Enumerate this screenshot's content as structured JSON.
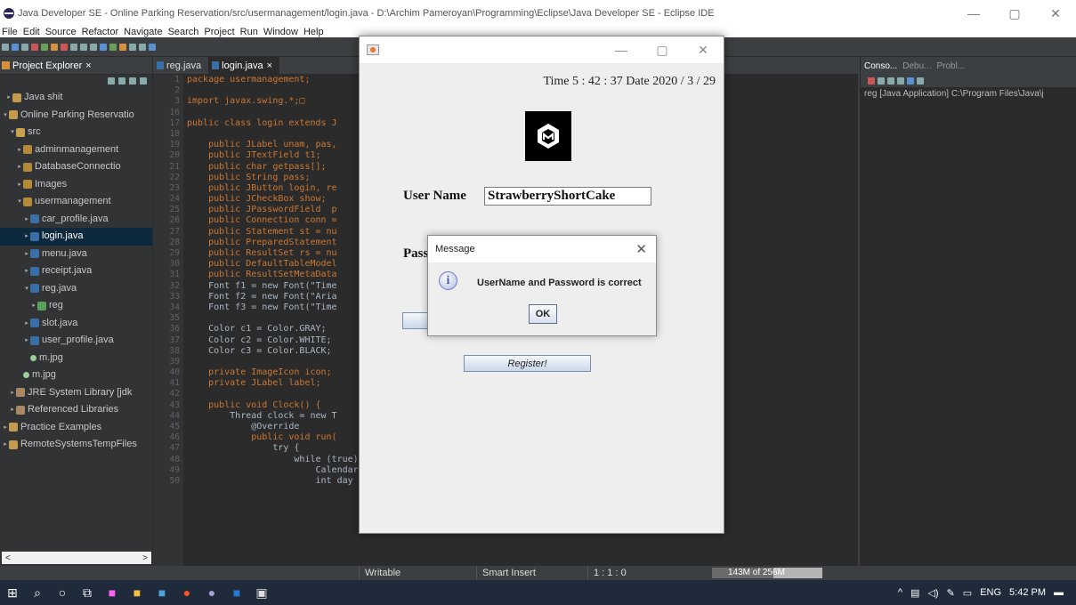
{
  "window": {
    "title": "Java Developer SE - Online Parking Reservation/src/usermanagement/login.java - D:\\Archim Pameroyan\\Programming\\Eclipse\\Java Developer SE - Eclipse IDE",
    "minimize": "—",
    "maximize": "▢",
    "close": "✕"
  },
  "menu": [
    "File",
    "Edit",
    "Source",
    "Refactor",
    "Navigate",
    "Search",
    "Project",
    "Run",
    "Window",
    "Help"
  ],
  "project_explorer": {
    "tab_label": "Project Explorer",
    "tab_close": "×",
    "items": [
      {
        "label": "Java shit",
        "twisty": "▸",
        "icon": "proj"
      },
      {
        "label": "Online Parking Reservatio",
        "twisty": "▾",
        "icon": "proj"
      },
      {
        "label": "src",
        "twisty": "▾",
        "icon": "src"
      },
      {
        "label": "adminmanagement",
        "twisty": "▸",
        "icon": "pkg"
      },
      {
        "label": "DatabaseConnectio",
        "twisty": "▸",
        "icon": "pkg"
      },
      {
        "label": "Images",
        "twisty": "▸",
        "icon": "pkg"
      },
      {
        "label": "usermanagement",
        "twisty": "▾",
        "icon": "pkg"
      },
      {
        "label": "car_profile.java",
        "twisty": "▸",
        "icon": "java"
      },
      {
        "label": "login.java",
        "twisty": "▸",
        "icon": "java",
        "selected": true
      },
      {
        "label": "menu.java",
        "twisty": "▸",
        "icon": "java"
      },
      {
        "label": "receipt.java",
        "twisty": "▸",
        "icon": "java"
      },
      {
        "label": "reg.java",
        "twisty": "▾",
        "icon": "java"
      },
      {
        "label": "reg",
        "twisty": "▸",
        "icon": "cls"
      },
      {
        "label": "slot.java",
        "twisty": "▸",
        "icon": "java"
      },
      {
        "label": "user_profile.java",
        "twisty": "▸",
        "icon": "java"
      },
      {
        "label": "m.jpg",
        "twisty": "",
        "icon": "img"
      },
      {
        "label": "m.jpg",
        "twisty": "",
        "icon": "img"
      },
      {
        "label": "JRE System Library [jdk",
        "twisty": "▸",
        "icon": "lib"
      },
      {
        "label": "Referenced Libraries",
        "twisty": "▸",
        "icon": "lib"
      },
      {
        "label": "Practice Examples",
        "twisty": "▸",
        "icon": "proj"
      },
      {
        "label": "RemoteSystemsTempFiles",
        "twisty": "▸",
        "icon": "proj"
      }
    ],
    "scroll_left": "<",
    "scroll_right": ">"
  },
  "editor": {
    "tabs": [
      {
        "label": "reg.java",
        "active": false
      },
      {
        "label": "login.java",
        "active": true,
        "close": "×"
      }
    ],
    "lines": [
      {
        "n": "1",
        "t": "package usermanagement;"
      },
      {
        "n": "2",
        "t": ""
      },
      {
        "n": "3",
        "t": "import javax.swing.*;□"
      },
      {
        "n": "16",
        "t": ""
      },
      {
        "n": "17",
        "t": "public class login extends J"
      },
      {
        "n": "18",
        "t": ""
      },
      {
        "n": "19",
        "t": "    public JLabel unam, pas,"
      },
      {
        "n": "20",
        "t": "    public JTextField t1;"
      },
      {
        "n": "21",
        "t": "    public char getpass[];"
      },
      {
        "n": "22",
        "t": "    public String pass;"
      },
      {
        "n": "23",
        "t": "    public JButton login, re"
      },
      {
        "n": "24",
        "t": "    public JCheckBox show;"
      },
      {
        "n": "25",
        "t": "    public JPasswordField  p"
      },
      {
        "n": "26",
        "t": "    public Connection conn ="
      },
      {
        "n": "27",
        "t": "    public Statement st = nu"
      },
      {
        "n": "28",
        "t": "    public PreparedStatement"
      },
      {
        "n": "29",
        "t": "    public ResultSet rs = nu"
      },
      {
        "n": "30",
        "t": "    public DefaultTableModel"
      },
      {
        "n": "31",
        "t": "    public ResultSetMetaData"
      },
      {
        "n": "32",
        "t": "    Font f1 = new Font(\"Time"
      },
      {
        "n": "33",
        "t": "    Font f2 = new Font(\"Aria"
      },
      {
        "n": "34",
        "t": "    Font f3 = new Font(\"Time"
      },
      {
        "n": "35",
        "t": ""
      },
      {
        "n": "36",
        "t": "    Color c1 = Color.GRAY;"
      },
      {
        "n": "37",
        "t": "    Color c2 = Color.WHITE;"
      },
      {
        "n": "38",
        "t": "    Color c3 = Color.BLACK;"
      },
      {
        "n": "39",
        "t": ""
      },
      {
        "n": "40",
        "t": "    private ImageIcon icon;"
      },
      {
        "n": "41",
        "t": "    private JLabel label;"
      },
      {
        "n": "42",
        "t": ""
      },
      {
        "n": "43",
        "t": "    public void Clock() {"
      },
      {
        "n": "44",
        "t": "        Thread clock = new T"
      },
      {
        "n": "45",
        "t": "            @Override"
      },
      {
        "n": "46",
        "t": "            public void run("
      },
      {
        "n": "47",
        "t": "                try {"
      },
      {
        "n": "48",
        "t": "                    while (true) {"
      },
      {
        "n": "49",
        "t": "                        Calendar cal = new GregorianCalendar();"
      },
      {
        "n": "50",
        "t": "                        int day = cal.get(Calendar.DAY_OF_MONTH);"
      }
    ]
  },
  "console": {
    "tabs": [
      "Conso...",
      "Debu...",
      "Probl..."
    ],
    "text": "reg [Java Application] C:\\Program Files\\Java\\j"
  },
  "status": {
    "writable": "Writable",
    "insert_mode": "Smart Insert",
    "position": "1 : 1 : 0",
    "heap": "143M of 256M",
    "heap_fraction": 0.56
  },
  "java_frame": {
    "clock_text": "Time 5 : 42 : 37 Date 2020 / 3 / 29",
    "username_label": "User Name",
    "username_value": "StrawberryShortCake",
    "password_label": "Pass",
    "register_button": "Register!"
  },
  "message_dialog": {
    "title": "Message",
    "close": "✕",
    "icon": "i",
    "message": "UserName and Password is correct",
    "ok_button": "OK"
  },
  "taskbar": {
    "tray_lang": "ENG",
    "time": "5:42 PM"
  }
}
